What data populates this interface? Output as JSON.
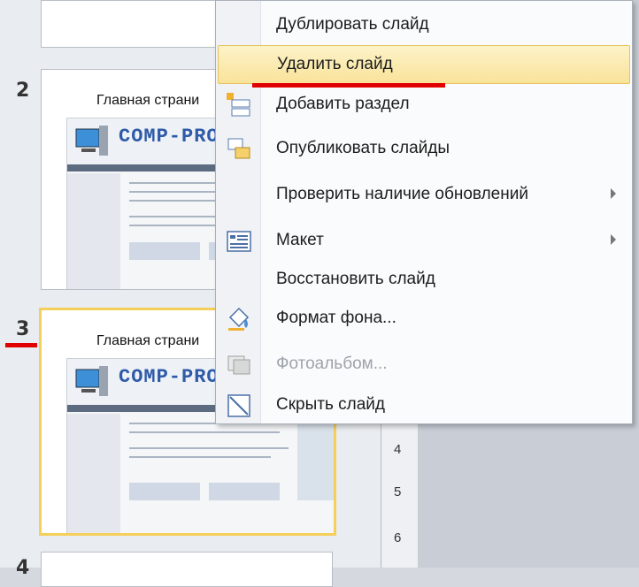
{
  "slides": {
    "items": [
      {
        "number": "",
        "title": ""
      },
      {
        "number": "2",
        "title": "Главная страни"
      },
      {
        "number": "3",
        "title": "Главная страни"
      },
      {
        "number": "4",
        "title": ""
      }
    ],
    "logo_text": "COMP-PROFI",
    "selected_index": 3
  },
  "ruler": {
    "numbers": [
      "4",
      "5",
      "6"
    ]
  },
  "context_menu": {
    "items": [
      {
        "label": "Дублировать слайд",
        "icon": "none",
        "submenu": false,
        "disabled": false
      },
      {
        "label": "Удалить слайд",
        "icon": "none",
        "submenu": false,
        "disabled": false,
        "highlighted": true
      },
      {
        "label": "Добавить раздел",
        "icon": "add-section-icon",
        "submenu": false,
        "disabled": false
      },
      {
        "label": "Опубликовать слайды",
        "icon": "publish-slides-icon",
        "submenu": false,
        "disabled": false
      },
      {
        "label": "Проверить наличие обновлений",
        "icon": "none",
        "submenu": true,
        "disabled": false
      },
      {
        "label": "Макет",
        "icon": "layout-icon",
        "submenu": true,
        "disabled": false
      },
      {
        "label": "Восстановить слайд",
        "icon": "none",
        "submenu": false,
        "disabled": false
      },
      {
        "label": "Формат фона...",
        "icon": "format-background-icon",
        "submenu": false,
        "disabled": false
      },
      {
        "label": "Фотоальбом...",
        "icon": "photo-album-icon",
        "submenu": false,
        "disabled": true
      },
      {
        "label": "Скрыть слайд",
        "icon": "hide-slide-icon",
        "submenu": false,
        "disabled": false
      }
    ]
  },
  "colors": {
    "highlight": "#f9e39a",
    "annotation_red": "#e00000",
    "selected_slide_border": "#f5cf5a"
  }
}
